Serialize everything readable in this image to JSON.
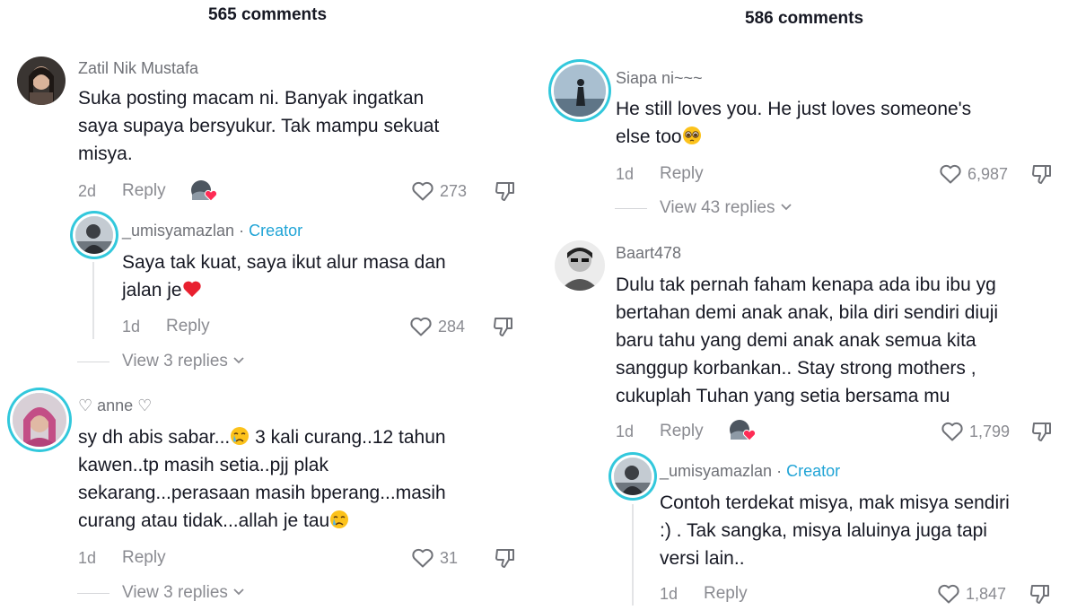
{
  "panels": [
    {
      "comment_count": "565 comments",
      "comments": [
        {
          "username": "Zatil Nik Mustafa",
          "lines": [
            "Suka posting macam ni. Banyak ingatkan",
            "saya supaya bersyukur. Tak mampu sekuat",
            "misya."
          ],
          "time": "2d",
          "reply_label": "Reply",
          "likes": "273",
          "reply": {
            "username": "_umisyamazlan",
            "separator": "·",
            "badge": "Creator",
            "lines": [
              "Saya tak kuat, saya ikut alur masa dan",
              "jalan je"
            ],
            "emoji": "red-heart",
            "time": "1d",
            "reply_label": "Reply",
            "likes": "284"
          },
          "view_replies": "View 3 replies"
        },
        {
          "username": "♡ anne ♡",
          "line1_a": "sy dh abis sabar...",
          "line1_b": " 3 kali curang..12 tahun",
          "lines": [
            "kawen..tp masih setia..pjj plak",
            "sekarang...perasaan masih bperang...masih"
          ],
          "line4": "curang atau tidak...allah je tau",
          "emoji": "crying-face",
          "time": "1d",
          "reply_label": "Reply",
          "likes": "31",
          "view_replies": "View 3 replies"
        }
      ]
    },
    {
      "comment_count": "586 comments",
      "comments": [
        {
          "username": "Siapa ni~~~",
          "lines": [
            "He still loves you. He just loves someone's",
            "else too"
          ],
          "emoji": "pleading-face",
          "time": "1d",
          "reply_label": "Reply",
          "likes": "6,987",
          "view_replies": "View 43 replies"
        },
        {
          "username": "Baart478",
          "lines": [
            "Dulu tak pernah faham kenapa ada ibu ibu yg",
            "bertahan demi anak anak, bila diri sendiri diuji",
            "baru tahu yang demi anak anak semua kita",
            "sanggup korbankan.. Stay strong mothers ,",
            "cukuplah Tuhan yang setia bersama mu"
          ],
          "time": "1d",
          "reply_label": "Reply",
          "likes": "1,799",
          "reply": {
            "username": "_umisyamazlan",
            "separator": "·",
            "badge": "Creator",
            "lines": [
              "Contoh terdekat misya, mak misya sendiri",
              ":) . Tak sangka, misya laluinya juga tapi",
              "versi lain.."
            ],
            "time": "1d",
            "reply_label": "Reply",
            "likes": "1,847"
          }
        }
      ]
    }
  ],
  "icons": [
    "heart-outline-icon",
    "dislike-icon",
    "chevron-down-icon",
    "creator-liked-avatar-icon"
  ],
  "colors": {
    "creator": "#20a4d6",
    "avatar_ring": "#32c8dc",
    "muted_text": "#8a8b91",
    "heart": "#fe2c55"
  }
}
